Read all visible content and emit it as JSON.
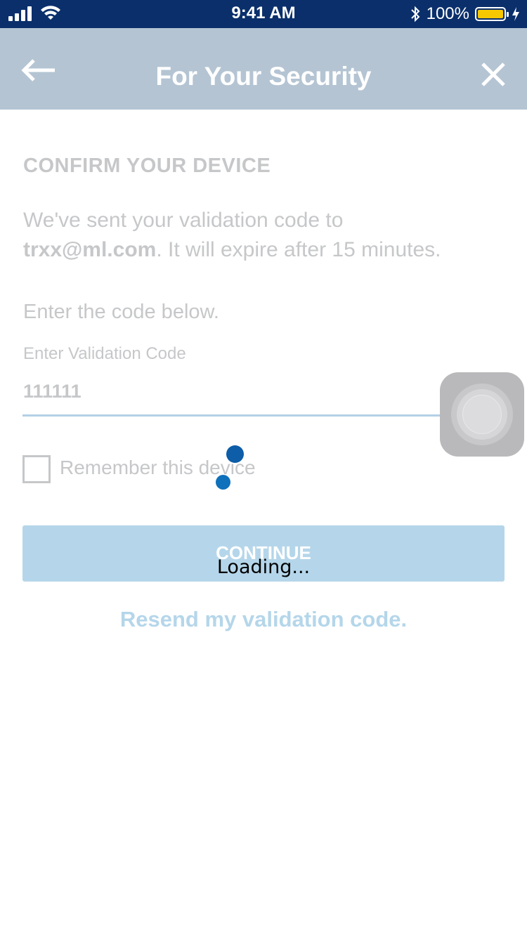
{
  "status_bar": {
    "time": "9:41 AM",
    "battery_percent": "100%",
    "battery_level": 1.0,
    "icons": [
      "cellular-signal-icon",
      "wifi-icon",
      "bluetooth-icon",
      "battery-icon",
      "charging-bolt-icon"
    ]
  },
  "nav": {
    "title": "For Your Security",
    "back_icon": "back-arrow-icon",
    "close_icon": "close-icon"
  },
  "content": {
    "section_title": "CONFIRM YOUR DEVICE",
    "description_prefix": "We've sent your validation code to",
    "email": "trxx@ml.com",
    "description_suffix": ". It will expire after 15 minutes.",
    "instruction": "Enter the code below.",
    "code_field": {
      "label": "Enter Validation Code",
      "value": "111111"
    },
    "remember_device": {
      "label": "Remember this device",
      "checked": false
    },
    "continue_button": "CONTINUE",
    "loading_text": "Loading...",
    "resend_link": "Resend my validation code."
  },
  "colors": {
    "status_bar_bg": "#0a2f6b",
    "nav_bg": "#b4c4d3",
    "muted_text": "#c6c7c9",
    "button_bg": "#b5d6ea",
    "link": "#b5d6ea",
    "battery_fill": "#f6c800"
  }
}
